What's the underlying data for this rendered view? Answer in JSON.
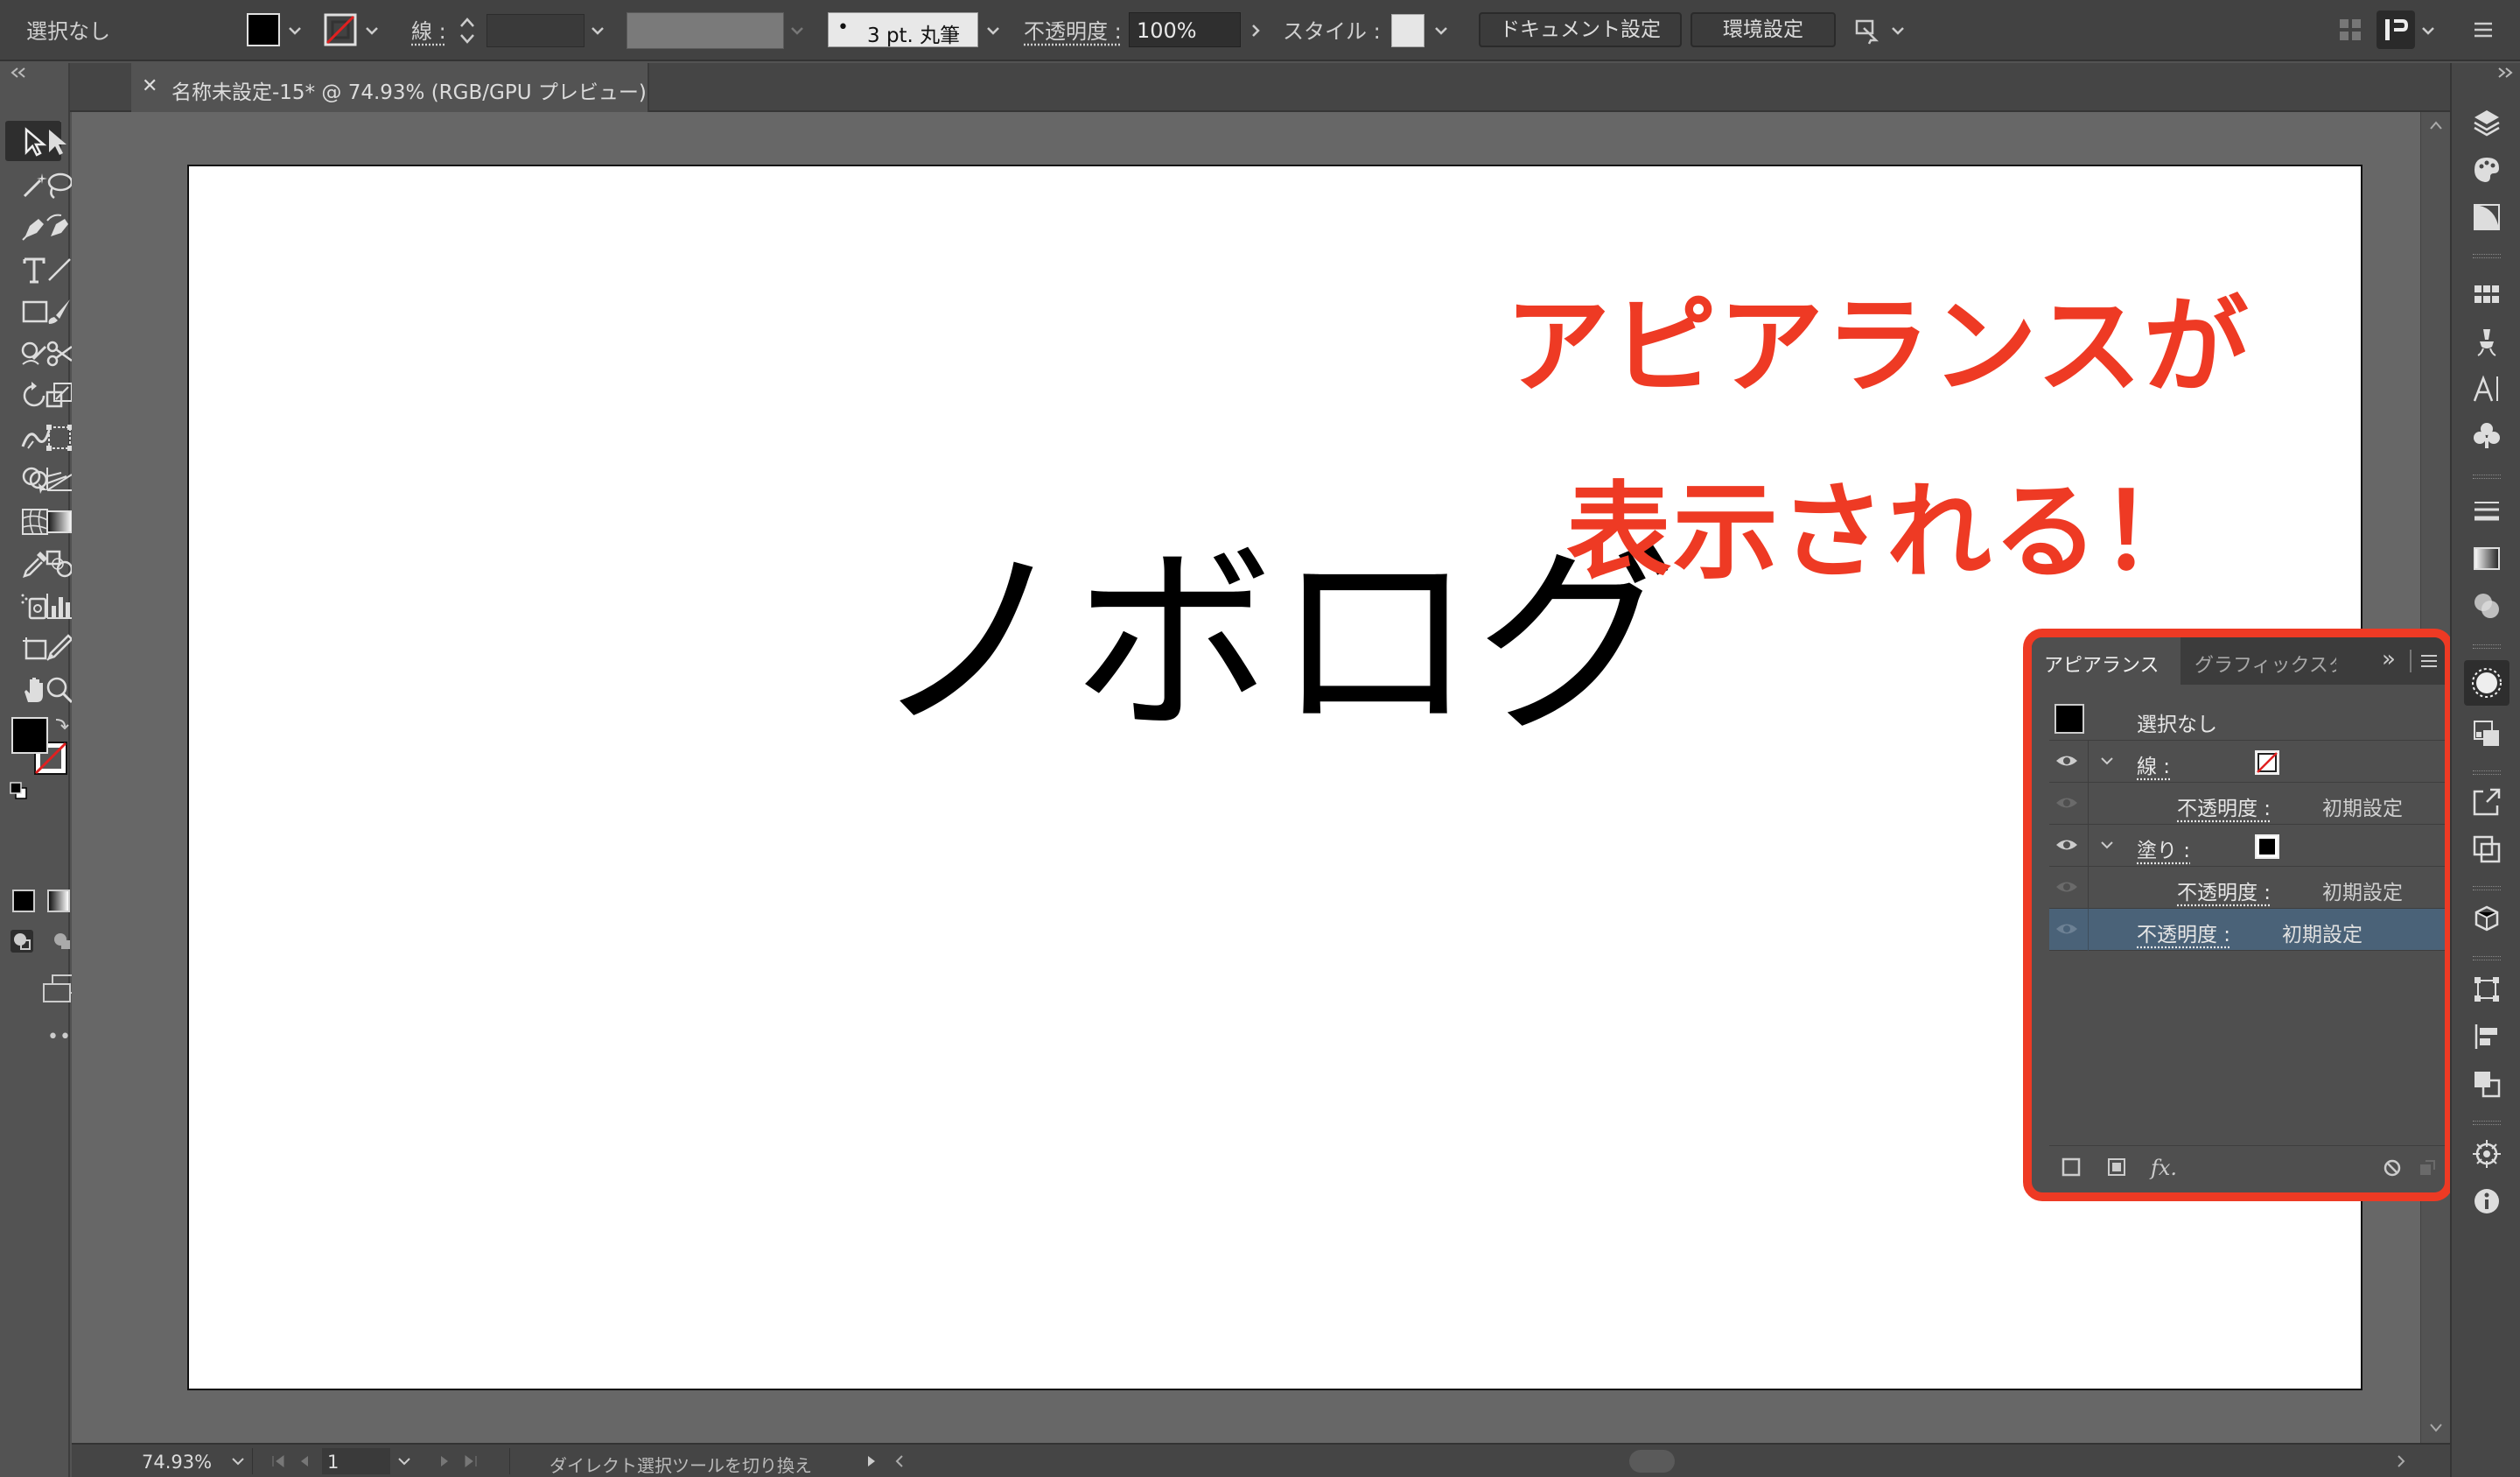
{
  "control_bar": {
    "selection_status": "選択なし",
    "stroke_label": "線 :",
    "brush_label": "3 pt. 丸筆",
    "brush_dot": "•",
    "opacity_label": "不透明度 :",
    "opacity_value": "100%",
    "style_label": "スタイル :",
    "document_settings_button": "ドキュメント設定",
    "preferences_button": "環境設定"
  },
  "document_tab": {
    "close_glyph": "✕",
    "title": "名称未設定-15* @ 74.93% (RGB/GPU プレビュー)"
  },
  "artboard": {
    "main_text": "ノボログ"
  },
  "callout": {
    "line1": "アピアランスが",
    "line2": "表示される！",
    "color": "#ee3a24"
  },
  "appearance_panel": {
    "tabs": [
      "アピアランス",
      "グラフィックスタ"
    ],
    "tab_overflow": "»",
    "header": "選択なし",
    "rows": [
      {
        "label": "線 :",
        "kind": "stroke"
      },
      {
        "label": "不透明度 :",
        "value": "初期設定",
        "kind": "sub"
      },
      {
        "label": "塗り :",
        "kind": "fill"
      },
      {
        "label": "不透明度 :",
        "value": "初期設定",
        "kind": "sub"
      },
      {
        "label": "不透明度 :",
        "value": "初期設定",
        "kind": "selected"
      }
    ],
    "fx_label": "fx."
  },
  "status_bar": {
    "zoom": "74.93%",
    "artboard_number": "1",
    "status_text": "ダイレクト選択ツールを切り換え"
  },
  "left_toolbar": {
    "more_label": "•••"
  },
  "colors": {
    "fill": "#000000",
    "stroke": "none",
    "selection_highlight": "#4a6278"
  }
}
